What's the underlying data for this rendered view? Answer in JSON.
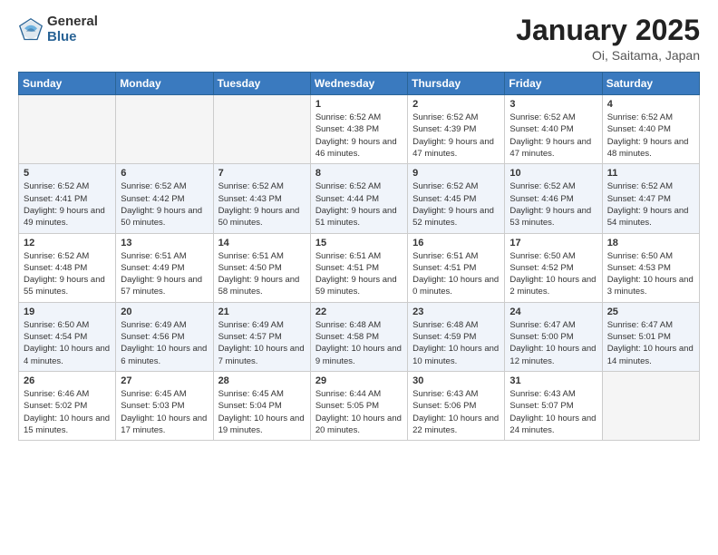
{
  "logo": {
    "general": "General",
    "blue": "Blue"
  },
  "header": {
    "month": "January 2025",
    "location": "Oi, Saitama, Japan"
  },
  "weekdays": [
    "Sunday",
    "Monday",
    "Tuesday",
    "Wednesday",
    "Thursday",
    "Friday",
    "Saturday"
  ],
  "weeks": [
    [
      {
        "day": "",
        "info": ""
      },
      {
        "day": "",
        "info": ""
      },
      {
        "day": "",
        "info": ""
      },
      {
        "day": "1",
        "info": "Sunrise: 6:52 AM\nSunset: 4:38 PM\nDaylight: 9 hours and 46 minutes."
      },
      {
        "day": "2",
        "info": "Sunrise: 6:52 AM\nSunset: 4:39 PM\nDaylight: 9 hours and 47 minutes."
      },
      {
        "day": "3",
        "info": "Sunrise: 6:52 AM\nSunset: 4:40 PM\nDaylight: 9 hours and 47 minutes."
      },
      {
        "day": "4",
        "info": "Sunrise: 6:52 AM\nSunset: 4:40 PM\nDaylight: 9 hours and 48 minutes."
      }
    ],
    [
      {
        "day": "5",
        "info": "Sunrise: 6:52 AM\nSunset: 4:41 PM\nDaylight: 9 hours and 49 minutes."
      },
      {
        "day": "6",
        "info": "Sunrise: 6:52 AM\nSunset: 4:42 PM\nDaylight: 9 hours and 50 minutes."
      },
      {
        "day": "7",
        "info": "Sunrise: 6:52 AM\nSunset: 4:43 PM\nDaylight: 9 hours and 50 minutes."
      },
      {
        "day": "8",
        "info": "Sunrise: 6:52 AM\nSunset: 4:44 PM\nDaylight: 9 hours and 51 minutes."
      },
      {
        "day": "9",
        "info": "Sunrise: 6:52 AM\nSunset: 4:45 PM\nDaylight: 9 hours and 52 minutes."
      },
      {
        "day": "10",
        "info": "Sunrise: 6:52 AM\nSunset: 4:46 PM\nDaylight: 9 hours and 53 minutes."
      },
      {
        "day": "11",
        "info": "Sunrise: 6:52 AM\nSunset: 4:47 PM\nDaylight: 9 hours and 54 minutes."
      }
    ],
    [
      {
        "day": "12",
        "info": "Sunrise: 6:52 AM\nSunset: 4:48 PM\nDaylight: 9 hours and 55 minutes."
      },
      {
        "day": "13",
        "info": "Sunrise: 6:51 AM\nSunset: 4:49 PM\nDaylight: 9 hours and 57 minutes."
      },
      {
        "day": "14",
        "info": "Sunrise: 6:51 AM\nSunset: 4:50 PM\nDaylight: 9 hours and 58 minutes."
      },
      {
        "day": "15",
        "info": "Sunrise: 6:51 AM\nSunset: 4:51 PM\nDaylight: 9 hours and 59 minutes."
      },
      {
        "day": "16",
        "info": "Sunrise: 6:51 AM\nSunset: 4:51 PM\nDaylight: 10 hours and 0 minutes."
      },
      {
        "day": "17",
        "info": "Sunrise: 6:50 AM\nSunset: 4:52 PM\nDaylight: 10 hours and 2 minutes."
      },
      {
        "day": "18",
        "info": "Sunrise: 6:50 AM\nSunset: 4:53 PM\nDaylight: 10 hours and 3 minutes."
      }
    ],
    [
      {
        "day": "19",
        "info": "Sunrise: 6:50 AM\nSunset: 4:54 PM\nDaylight: 10 hours and 4 minutes."
      },
      {
        "day": "20",
        "info": "Sunrise: 6:49 AM\nSunset: 4:56 PM\nDaylight: 10 hours and 6 minutes."
      },
      {
        "day": "21",
        "info": "Sunrise: 6:49 AM\nSunset: 4:57 PM\nDaylight: 10 hours and 7 minutes."
      },
      {
        "day": "22",
        "info": "Sunrise: 6:48 AM\nSunset: 4:58 PM\nDaylight: 10 hours and 9 minutes."
      },
      {
        "day": "23",
        "info": "Sunrise: 6:48 AM\nSunset: 4:59 PM\nDaylight: 10 hours and 10 minutes."
      },
      {
        "day": "24",
        "info": "Sunrise: 6:47 AM\nSunset: 5:00 PM\nDaylight: 10 hours and 12 minutes."
      },
      {
        "day": "25",
        "info": "Sunrise: 6:47 AM\nSunset: 5:01 PM\nDaylight: 10 hours and 14 minutes."
      }
    ],
    [
      {
        "day": "26",
        "info": "Sunrise: 6:46 AM\nSunset: 5:02 PM\nDaylight: 10 hours and 15 minutes."
      },
      {
        "day": "27",
        "info": "Sunrise: 6:45 AM\nSunset: 5:03 PM\nDaylight: 10 hours and 17 minutes."
      },
      {
        "day": "28",
        "info": "Sunrise: 6:45 AM\nSunset: 5:04 PM\nDaylight: 10 hours and 19 minutes."
      },
      {
        "day": "29",
        "info": "Sunrise: 6:44 AM\nSunset: 5:05 PM\nDaylight: 10 hours and 20 minutes."
      },
      {
        "day": "30",
        "info": "Sunrise: 6:43 AM\nSunset: 5:06 PM\nDaylight: 10 hours and 22 minutes."
      },
      {
        "day": "31",
        "info": "Sunrise: 6:43 AM\nSunset: 5:07 PM\nDaylight: 10 hours and 24 minutes."
      },
      {
        "day": "",
        "info": ""
      }
    ]
  ]
}
